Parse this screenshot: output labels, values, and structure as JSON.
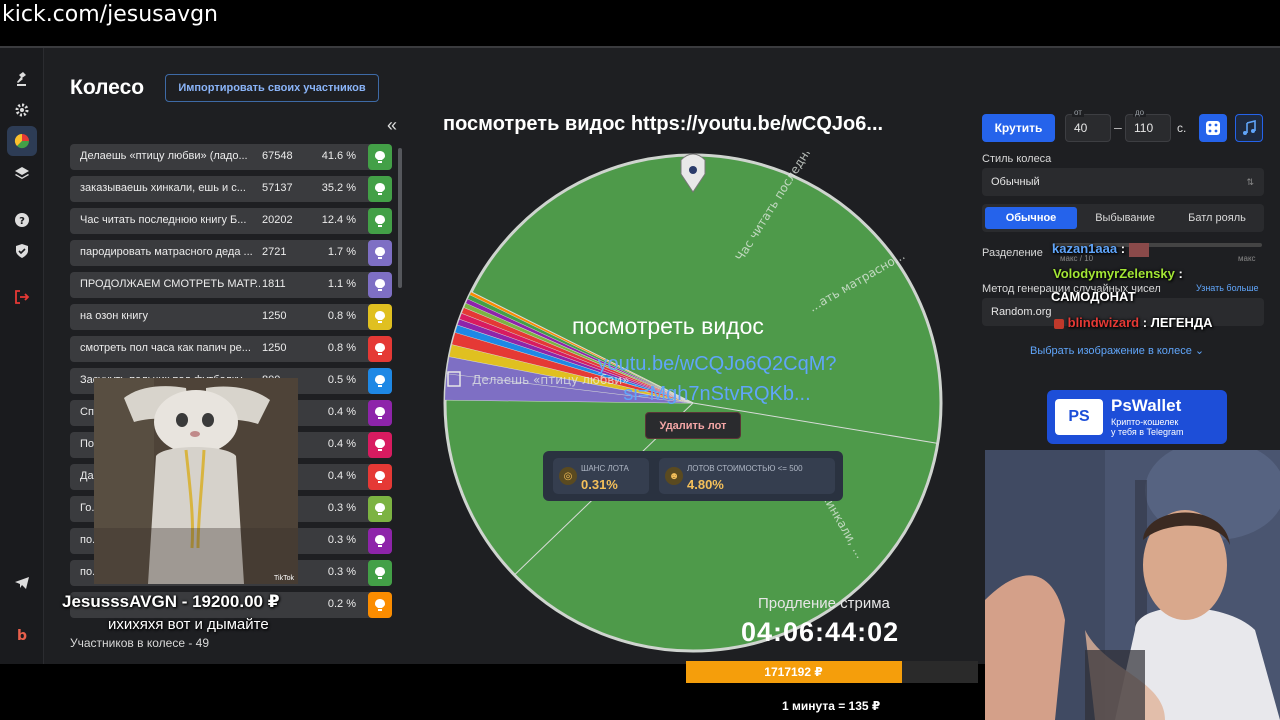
{
  "browser": {
    "url": "kick.com/jesusavgn"
  },
  "sidebar": {
    "icons": [
      "gavel-icon",
      "gear-icon",
      "wheel-icon",
      "layers-icon",
      "help-icon",
      "shield-icon",
      "logout-icon",
      "telegram-icon",
      "brand-icon"
    ]
  },
  "left_panel": {
    "title": "Колесо",
    "import_label": "Импортировать своих участников",
    "collapse_glyph": "«",
    "lots": [
      {
        "name": "Делаешь «птицу любви» (ладо...",
        "amount": "67548",
        "pct": "41.6 %",
        "color": "#43a047"
      },
      {
        "name": "заказываешь хинкали, ешь и с...",
        "amount": "57137",
        "pct": "35.2 %",
        "color": "#43a047"
      },
      {
        "name": "Час читать последнюю книгу Б...",
        "amount": "20202",
        "pct": "12.4 %",
        "color": "#43a047"
      },
      {
        "name": "пародировать матрасного деда ...",
        "amount": "2721",
        "pct": "1.7 %",
        "color": "#7e6fc4"
      },
      {
        "name": "ПРОДОЛЖАЕМ СМОТРЕТЬ МАТР...",
        "amount": "1811",
        "pct": "1.1 %",
        "color": "#7e6fc4"
      },
      {
        "name": "на озон книгу",
        "amount": "1250",
        "pct": "0.8 %",
        "color": "#e0c020"
      },
      {
        "name": "смотреть пол часа как папич ре...",
        "amount": "1250",
        "pct": "0.8 %",
        "color": "#e53935"
      },
      {
        "name": "Засунуть пальчик под футболку...",
        "amount": "800",
        "pct": "0.5 %",
        "color": "#1e88e5"
      },
      {
        "name": "Сп...",
        "amount": "",
        "pct": "0.4 %",
        "color": "#8e24aa"
      },
      {
        "name": "По...",
        "amount": "",
        "pct": "0.4 %",
        "color": "#d81b60"
      },
      {
        "name": "Да...",
        "amount": "",
        "pct": "0.4 %",
        "color": "#e53935"
      },
      {
        "name": "Го...",
        "amount": "",
        "pct": "0.3 %",
        "color": "#7cb342"
      },
      {
        "name": "по...",
        "amount": "",
        "pct": "0.3 %",
        "color": "#8e24aa"
      },
      {
        "name": "по...",
        "amount": "",
        "pct": "0.3 %",
        "color": "#43a047"
      },
      {
        "name": "",
        "amount": "",
        "pct": "0.2 %",
        "color": "#fb8c00"
      }
    ],
    "participants": "Участников в колесе - 49"
  },
  "overlay": {
    "tiktok_label": "TikTok",
    "donation": "JesusssAVGN - 19200.00 ₽",
    "donation_msg": "ихихяхя вот и дымайте"
  },
  "wheel": {
    "title": "посмотреть видос https://youtu.be/wCQJo6...",
    "center_title": "посмотреть видос",
    "center_link": "youtu.be/wCQJo6Q2CqM?si=Mgh7nStvRQKb...",
    "delete_label": "Удалить лот",
    "stats": [
      {
        "label": "ШАНС ЛОТА",
        "value": "0.31%",
        "icon": "target-icon"
      },
      {
        "label": "ЛОТОВ СТОИМОСТЬЮ <= 500",
        "value": "4.80%",
        "icon": "people-icon"
      }
    ],
    "slice_labels": [
      "Делаешь «птицу любви»",
      "Час читать последнюю...",
      "...ать матрасно...",
      "хинкали, ..."
    ],
    "stream_label": "Продление стрима",
    "timer": "04:06:44:02",
    "progress_text": "1717192 ₽",
    "progress_fraction": 0.74,
    "rate": "1 минута = 135 ₽"
  },
  "right_panel": {
    "spin_label": "Крутить",
    "from_caption": "от",
    "from_value": "40",
    "dash": "–",
    "to_caption": "до",
    "to_value": "110",
    "sec_label": "с.",
    "style_label": "Стиль колеса",
    "style_value": "Обычный",
    "modes": [
      "Обычное",
      "Выбывание",
      "Батл рояль"
    ],
    "split_label": "Разделение",
    "max_a": "макс / 10",
    "max_b": "макс",
    "method_label": "Метод генерации случайных чисел",
    "learn_more": "Узнать больше",
    "method_value": "Random.org",
    "choose_image": "Выбрать изображение в колесе"
  },
  "chat": [
    {
      "user": "kazan1aaa",
      "text": ":",
      "color": "#60a5fa"
    },
    {
      "user": "VolodymyrZelensky",
      "text": ":",
      "color": "#a3e635"
    },
    {
      "user": "",
      "text": "САМОДОНАТ",
      "color": "#ffffff"
    },
    {
      "user": "blindwizard",
      "text": ": ЛЕГЕНДА",
      "color": "#e53935"
    }
  ],
  "ad": {
    "name": "PsWallet",
    "logo": "PS",
    "sub1": "Крипто-кошелек",
    "sub2": "у тебя в Telegram"
  }
}
